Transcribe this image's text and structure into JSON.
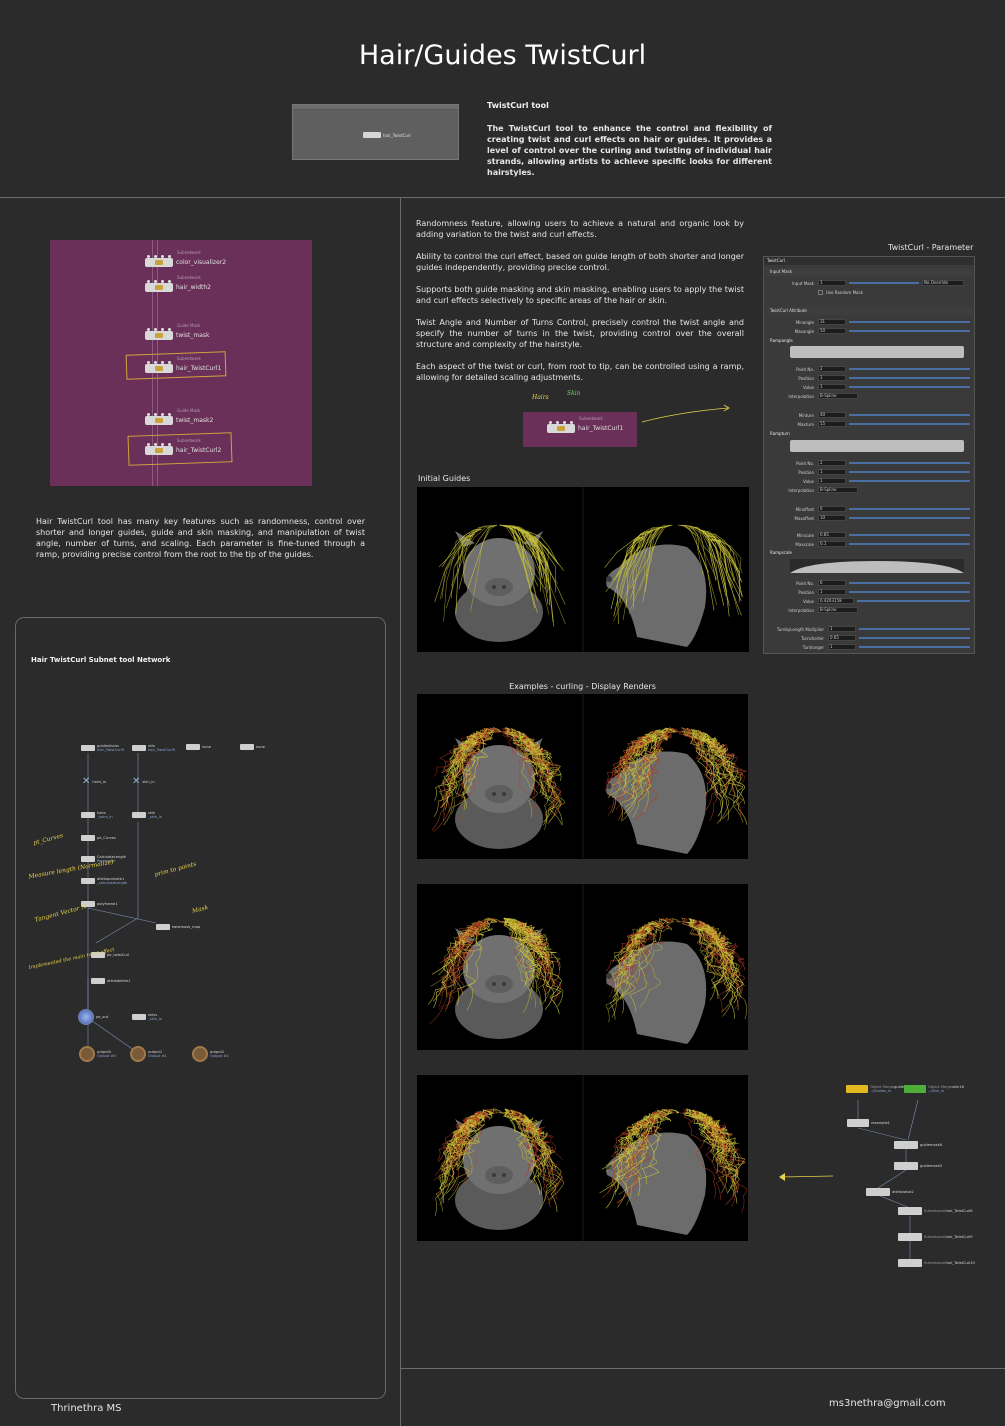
{
  "title": "Hair/Guides TwistCurl",
  "header": {
    "tool_heading": "TwistCurl tool",
    "tool_description": "The TwistCurl tool to enhance the control and flexibility of creating twist and curl effects on hair or guides. It provides a level of control over the curling and twisting of individual hair strands, allowing artists to achieve specific looks for different hairstyles.",
    "preview_node_label": "hair_TwistCurl"
  },
  "purple_network": {
    "nodes": [
      {
        "sub": "Subnetwork",
        "label": "color_visualizer2"
      },
      {
        "sub": "Subnetwork",
        "label": "hair_width2"
      },
      {
        "sub": "Guide Mask",
        "label": "twist_mask"
      },
      {
        "sub": "Subnetwork",
        "label": "hair_TwistCurl1"
      },
      {
        "sub": "Guide Mask",
        "label": "twist_mask2"
      },
      {
        "sub": "Subnetwork",
        "label": "hair_TwistCurl2"
      }
    ]
  },
  "left_description": "Hair TwistCurl tool has many key features such as randomness, control over shorter and longer guides, guide and skin masking, and manipulation of twist angle, number of turns, and scaling. Each parameter is fine-tuned through a ramp, providing precise control from the root to the tip of the guides.",
  "subnet": {
    "heading": "Hair TwistCurl Subnet tool Network",
    "inputs": [
      {
        "label": "guides/hairs",
        "sub": "hair_TwistCurl9"
      },
      {
        "label": "skin",
        "sub": "hair_TwistCurl9"
      },
      {
        "label": "none",
        "sub": ""
      },
      {
        "label": "none",
        "sub": ""
      }
    ],
    "nodes": [
      {
        "label": "hairs_in",
        "sub": ""
      },
      {
        "label": "skin_in",
        "sub": ""
      },
      {
        "label": "hairs",
        "sub": "_hairs_in"
      },
      {
        "label": "skin",
        "sub": "_skin_in"
      },
      {
        "label": "pe_Curves",
        "sub": ""
      },
      {
        "label": "CalculateLength",
        "sub": "Parameter"
      },
      {
        "label": "attribpromote1",
        "sub": "_calculateLength"
      },
      {
        "label": "polyframe1",
        "sub": ""
      },
      {
        "label": "twistmask_map",
        "sub": ""
      },
      {
        "label": "pe_twistCurl",
        "sub": ""
      },
      {
        "label": "attribdelete1",
        "sub": ""
      },
      {
        "label": "pe_out",
        "sub": ""
      },
      {
        "label": "skins",
        "sub": "_skin_in"
      },
      {
        "label": "output0",
        "sub": "Output #0"
      },
      {
        "label": "output1",
        "sub": "Output #1"
      },
      {
        "label": "output2",
        "sub": "Output #2"
      }
    ],
    "annotations": [
      "pt_Curves",
      "Measure length (Normalize)",
      "prim to points",
      "Tangent Vector N",
      "Mask",
      "Implemented the main twist effect"
    ]
  },
  "features": [
    "Randomness feature, allowing users to achieve a natural and organic look by adding variation to the twist and curl effects.",
    "Ability to control the curl effect, based on guide length of both shorter and longer guides independently, providing precise control.",
    "Supports both guide masking and skin masking, enabling users to apply the twist and curl effects selectively to specific areas of the hair or skin.",
    "Twist Angle and  Number of Turns Control, precisely control the twist angle and specify the number of turns in the twist, providing control over the overall structure and complexity of the hairstyle.",
    "Each aspect of the twist or curl, from root to tip, can be controlled using a ramp, allowing for detailed scaling adjustments."
  ],
  "small_node": {
    "input_hairs": "Hairs",
    "input_skin": "Skin",
    "sub": "Subnetwork",
    "label": "hair_TwistCurl1"
  },
  "param_panel": {
    "heading": "TwistCurl - Parameter",
    "tab": "TwistCurl",
    "sections": [
      "Input Mask",
      "TwistCurl Attribute"
    ],
    "input_mask_label": "Input Mask",
    "input_mask_value": "1",
    "override": "No Override",
    "use_random_mask": "Use Random Mask",
    "minangle": {
      "label": "Minangle",
      "value": "31"
    },
    "maxangle": {
      "label": "Maxangle",
      "value": "50"
    },
    "rampangle": "Rampangle",
    "rampturn": "Rampturn",
    "rampscale": "Rampscale",
    "ramp_rows": [
      {
        "label": "Point No.",
        "value": "2"
      },
      {
        "label": "Position",
        "value": "1"
      },
      {
        "label": "Value",
        "value": "1"
      },
      {
        "label": "Interpolation",
        "value": "B-Spline"
      }
    ],
    "minturn": {
      "label": "Minturn",
      "value": "40"
    },
    "maxturn": {
      "label": "Maxturn",
      "value": "55"
    },
    "ramp2_rows": [
      {
        "label": "Point No.",
        "value": "2"
      },
      {
        "label": "Position",
        "value": "1"
      },
      {
        "label": "Value",
        "value": "1"
      },
      {
        "label": "Interpolation",
        "value": "B-Spline"
      }
    ],
    "minoffset": {
      "label": "Minoffset",
      "value": "0"
    },
    "maxoffset": {
      "label": "Maxoffset",
      "value": "10"
    },
    "minscale": {
      "label": "Minscale",
      "value": "0.85"
    },
    "maxscale": {
      "label": "Maxscale",
      "value": "0.1"
    },
    "ramp3_rows": [
      {
        "label": "Point No.",
        "value": "6"
      },
      {
        "label": "Position",
        "value": "1"
      },
      {
        "label": "Value",
        "value": "0.4203158"
      },
      {
        "label": "Interpolation",
        "value": "B-Spline"
      }
    ],
    "bottom_rows": [
      {
        "label": "TurnbyLength Multiplier",
        "value": "1"
      },
      {
        "label": "Turnshorter",
        "value": "0.65"
      },
      {
        "label": "Turnlonger",
        "value": "1"
      }
    ]
  },
  "labels": {
    "initial_guides": "Initial Guides",
    "examples": "Examples - curling  - Display Renders"
  },
  "right_network": {
    "nodes": [
      {
        "sub": "Object Merge",
        "label": "guides8",
        "sub2": "../Guides_in"
      },
      {
        "sub": "Object Merge",
        "label": "skin16",
        "sub2": "../Skin_in"
      },
      {
        "sub": "",
        "label": "resample1",
        "sub2": ""
      },
      {
        "sub": "",
        "label": "guidemask6",
        "sub2": ""
      },
      {
        "sub": "",
        "label": "guidemask5",
        "sub2": ""
      },
      {
        "sub": "",
        "label": "attribnoise2",
        "sub2": ""
      },
      {
        "sub": "Subnetwork",
        "label": "hair_TwistCurl8",
        "sub2": ""
      },
      {
        "sub": "Subnetwork",
        "label": "hair_TwistCurl9",
        "sub2": ""
      },
      {
        "sub": "Subnetwork",
        "label": "hair_TwistCurl10",
        "sub2": ""
      }
    ]
  },
  "footer": {
    "author": "Thrinethra MS",
    "email": "ms3nethra@gmail.com"
  },
  "colors": {
    "background": "#2b2b2b",
    "purple_panel": "#6a3059",
    "accent_yellow": "#e6d14a",
    "hair_yellow": "#c8c23a",
    "hair_red": "#b23a22"
  }
}
